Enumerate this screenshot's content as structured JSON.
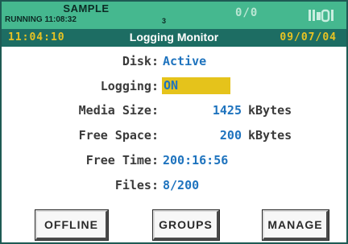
{
  "status": {
    "title": "SAMPLE",
    "running": "RUNNING 11:08:32",
    "count": "3",
    "ratio": "0/0"
  },
  "header": {
    "time": "11:04:10",
    "title": "Logging Monitor",
    "date": "09/07/04"
  },
  "rows": {
    "disk": {
      "label": "Disk:",
      "value": "Active"
    },
    "logging": {
      "label": "Logging:",
      "value": "ON"
    },
    "media_size": {
      "label": "Media Size:",
      "value": "1425",
      "unit": "kBytes"
    },
    "free_space": {
      "label": "Free Space:",
      "value": "200",
      "unit": "kBytes"
    },
    "free_time": {
      "label": "Free Time:",
      "value": "200:16:56"
    },
    "files": {
      "label": "Files:",
      "value": "8/200"
    }
  },
  "buttons": {
    "offline": "OFFLINE",
    "groups": "GROUPS",
    "manage": "MANAGE"
  },
  "colors": {
    "status_green": "#45b88f",
    "header_teal": "#1d6d63",
    "header_yellow": "#e8c323",
    "value_blue": "#1e73be",
    "logging_highlight": "#e5c31b"
  },
  "icons": {
    "signal": "signal-strength-icon"
  }
}
